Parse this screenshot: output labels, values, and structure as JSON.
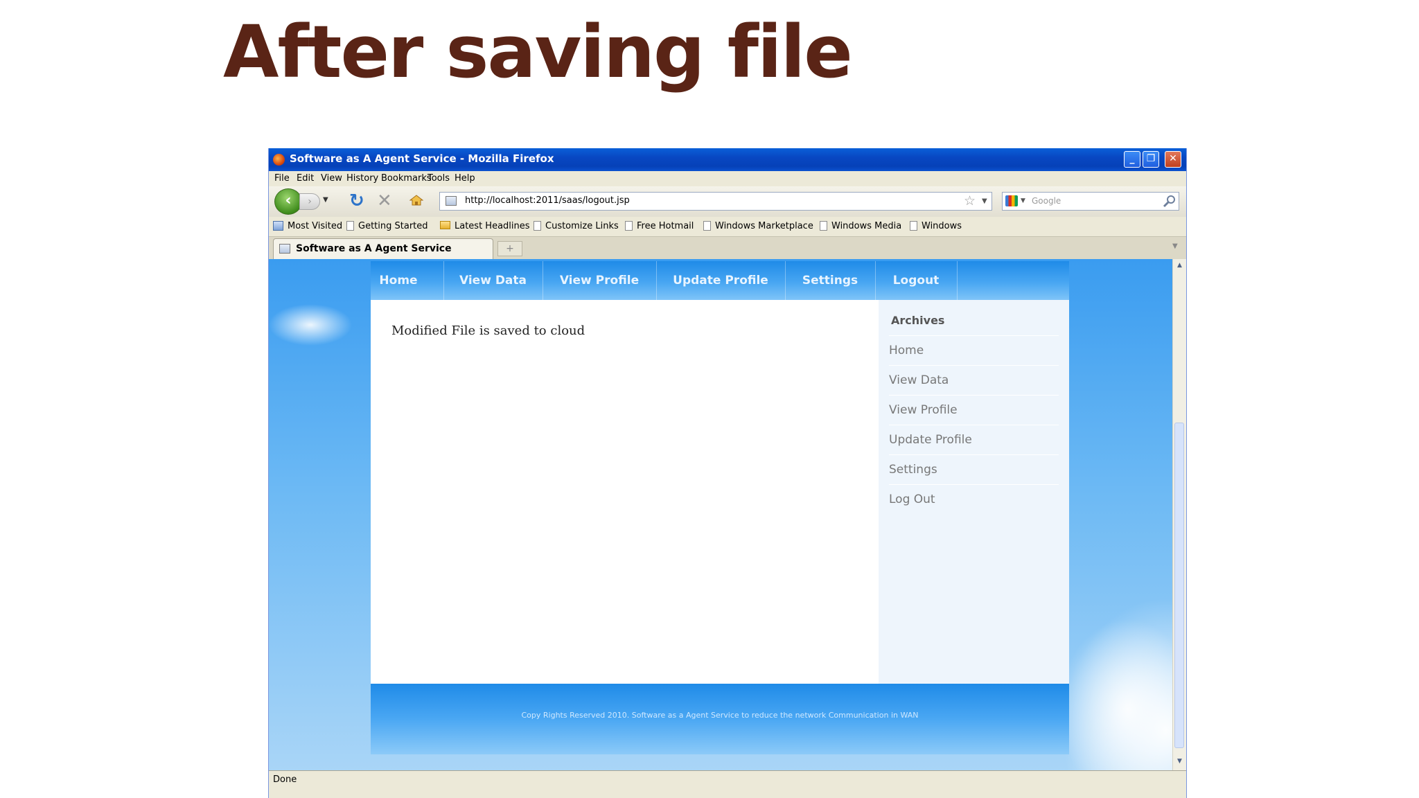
{
  "slide": {
    "title": "After saving file"
  },
  "window": {
    "title": "Software as A Agent Service - Mozilla Firefox",
    "menu": [
      "File",
      "Edit",
      "View",
      "History",
      "Bookmarks",
      "Tools",
      "Help"
    ],
    "url": "http://localhost:2011/saas/logout.jsp",
    "search_placeholder": "Google",
    "bookmarks": [
      "Most Visited",
      "Getting Started",
      "Latest Headlines",
      "Customize Links",
      "Free Hotmail",
      "Windows Marketplace",
      "Windows Media",
      "Windows"
    ],
    "tab_title": "Software as A Agent Service",
    "status": "Done"
  },
  "site": {
    "nav": [
      "Home",
      "View Data",
      "View Profile",
      "Update Profile",
      "Settings",
      "Logout"
    ],
    "message": "Modified File is saved to cloud",
    "sidebar_heading": "Archives",
    "sidebar_links": [
      "Home",
      "View Data",
      "View Profile",
      "Update Profile",
      "Settings",
      "Log Out"
    ],
    "footer": "Copy Rights Reserved 2010. Software as a Agent Service to reduce the network Communication in WAN"
  },
  "icons": {
    "back": "back-arrow-icon",
    "forward": "forward-arrow-icon",
    "reload": "reload-icon",
    "stop": "stop-icon",
    "home": "home-icon",
    "bookmark_star": "star-icon",
    "search": "magnifier-icon"
  }
}
